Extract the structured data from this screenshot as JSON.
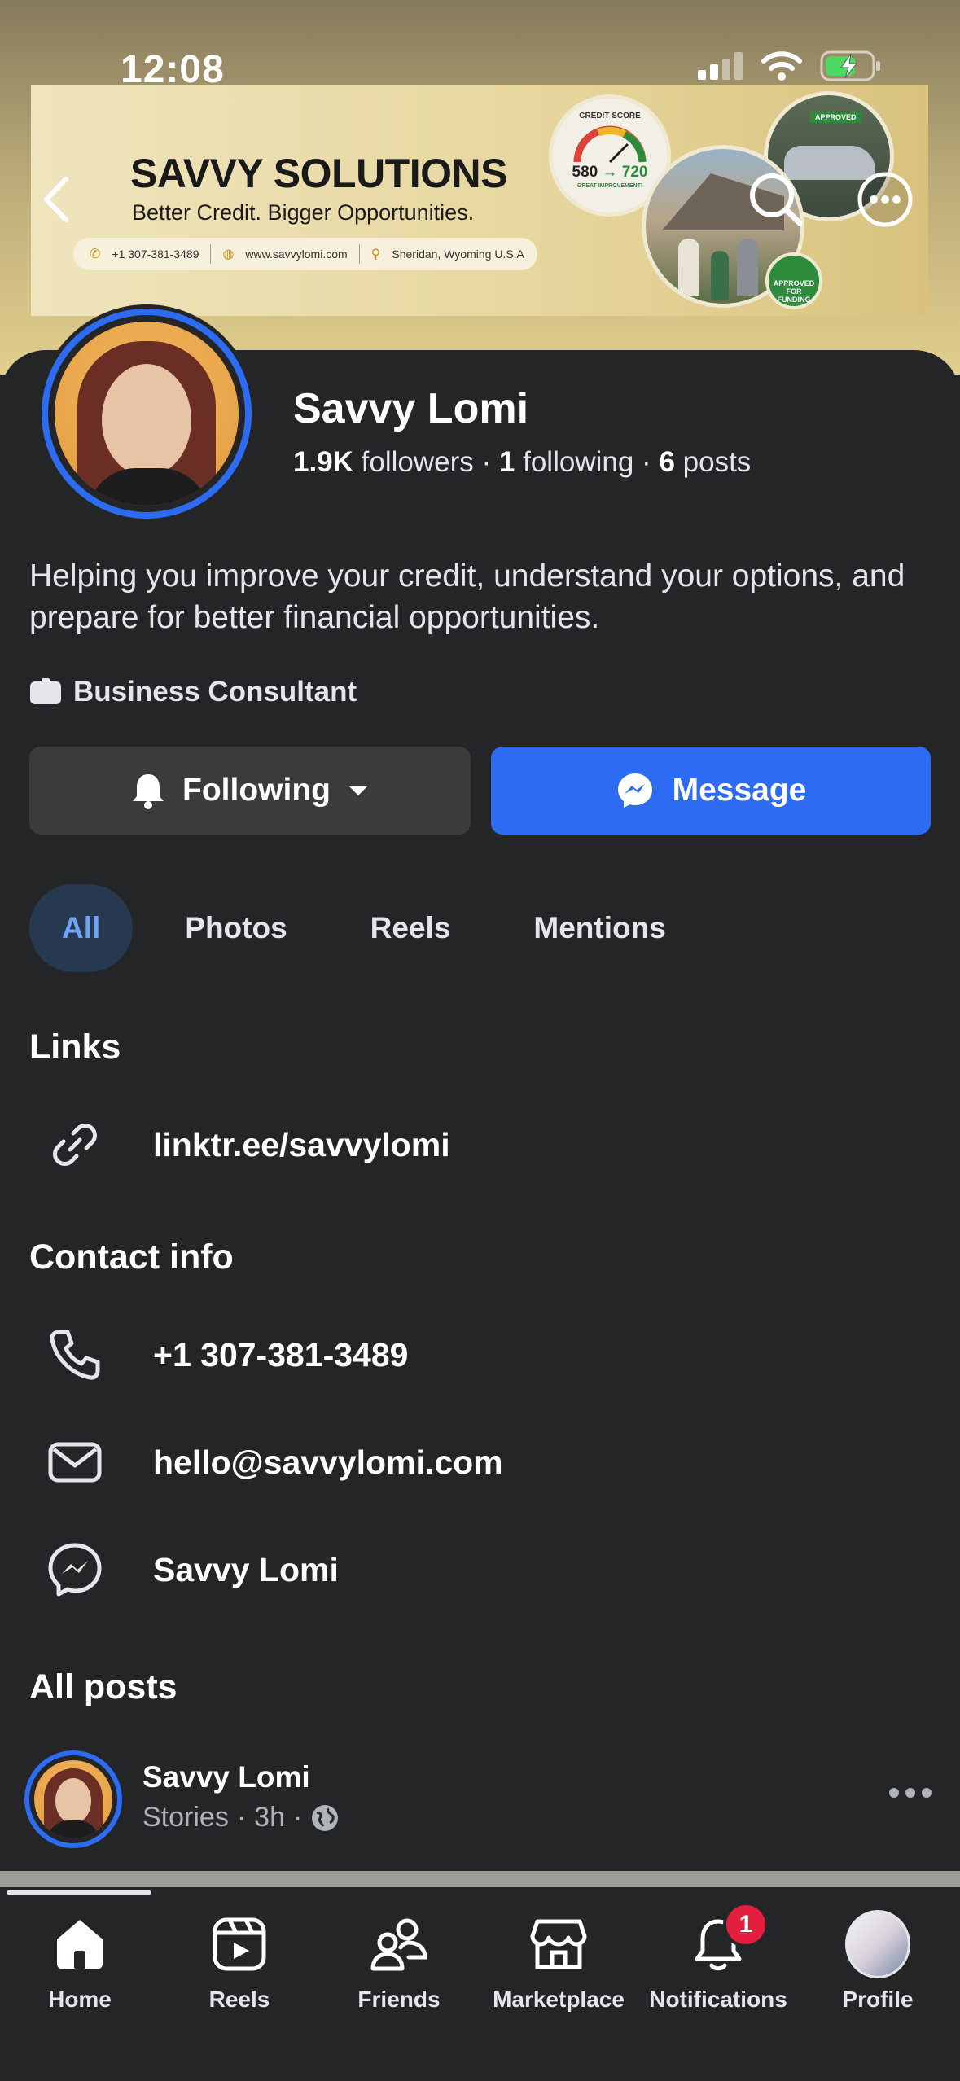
{
  "status_bar": {
    "time": "12:08"
  },
  "cover": {
    "brand_title": "SAVVY SOLUTIONS",
    "brand_tagline": "Better Credit. Bigger Opportunities.",
    "phone": "+1 307-381-3489",
    "website": "www.savvylomi.com",
    "location": "Sheridan, Wyoming U.S.A",
    "credit_label": "CREDIT SCORE",
    "credit_from": "580",
    "credit_to": "720",
    "credit_note": "GREAT IMPROVEMENT!",
    "approved_label": "APPROVED",
    "approved_funding": "APPROVED FOR FUNDING"
  },
  "profile": {
    "name": "Savvy Lomi",
    "followers_count": "1.9K",
    "followers_label": "followers",
    "following_count": "1",
    "following_label": "following",
    "posts_count": "6",
    "posts_label": "posts",
    "bio": "Helping you improve your credit, understand your options, and prepare for better financial opportunities.",
    "category": "Business Consultant"
  },
  "actions": {
    "following_label": "Following",
    "message_label": "Message"
  },
  "tabs": [
    {
      "label": "All",
      "active": true
    },
    {
      "label": "Photos"
    },
    {
      "label": "Reels"
    },
    {
      "label": "Mentions"
    }
  ],
  "links": {
    "title": "Links",
    "url": "linktr.ee/savvylomi"
  },
  "contact": {
    "title": "Contact info",
    "phone": "+1 307-381-3489",
    "email": "hello@savvylomi.com",
    "messenger": "Savvy Lomi"
  },
  "posts": {
    "title": "All posts",
    "author": "Savvy Lomi",
    "source": "Stories",
    "time": "3h"
  },
  "bottom_nav": [
    {
      "label": "Home",
      "icon": "home-icon"
    },
    {
      "label": "Reels",
      "icon": "reels-icon"
    },
    {
      "label": "Friends",
      "icon": "friends-icon"
    },
    {
      "label": "Marketplace",
      "icon": "marketplace-icon"
    },
    {
      "label": "Notifications",
      "icon": "bell-icon",
      "badge": "1"
    },
    {
      "label": "Profile",
      "icon": "profile-avatar"
    }
  ],
  "colors": {
    "accent": "#2D6CF2",
    "background": "#242526",
    "button_secondary": "#3A3B3C",
    "badge": "#E41E3F"
  }
}
